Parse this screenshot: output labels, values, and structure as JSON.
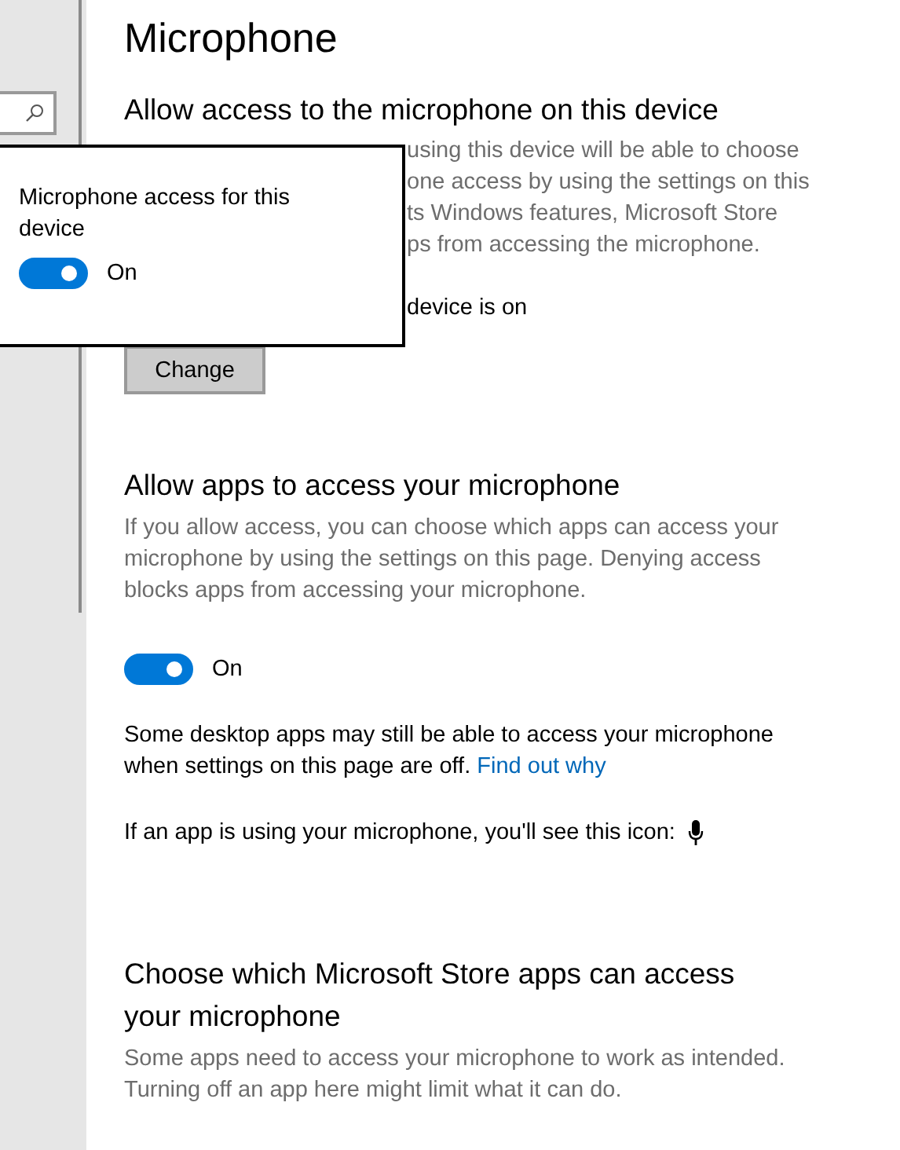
{
  "title": "Microphone",
  "device_section": {
    "heading": "Allow access to the microphone on this device",
    "description_lines": [
      "using this device will be able to choose",
      "one access by using the settings on this",
      "ts Windows features, Microsoft Store",
      "ps from accessing the microphone."
    ],
    "status": "device is on",
    "button": "Change"
  },
  "flyout": {
    "title": "Microphone access for this device",
    "toggle": {
      "on": true,
      "label": "On"
    }
  },
  "apps_section": {
    "heading": "Allow apps to access your microphone",
    "description": "If you allow access, you can choose which apps can access your microphone by using the settings on this page. Denying access blocks apps from accessing your microphone.",
    "toggle": {
      "on": true,
      "label": "On"
    },
    "note": "Some desktop apps may still be able to access your microphone when settings on this page are off.",
    "link": "Find out why",
    "icon_note": "If an app is using your microphone, you'll see this icon:"
  },
  "store_section": {
    "heading": "Choose which Microsoft Store apps can access your microphone",
    "description": "Some apps need to access your microphone to work as intended. Turning off an app here might limit what it can do."
  }
}
